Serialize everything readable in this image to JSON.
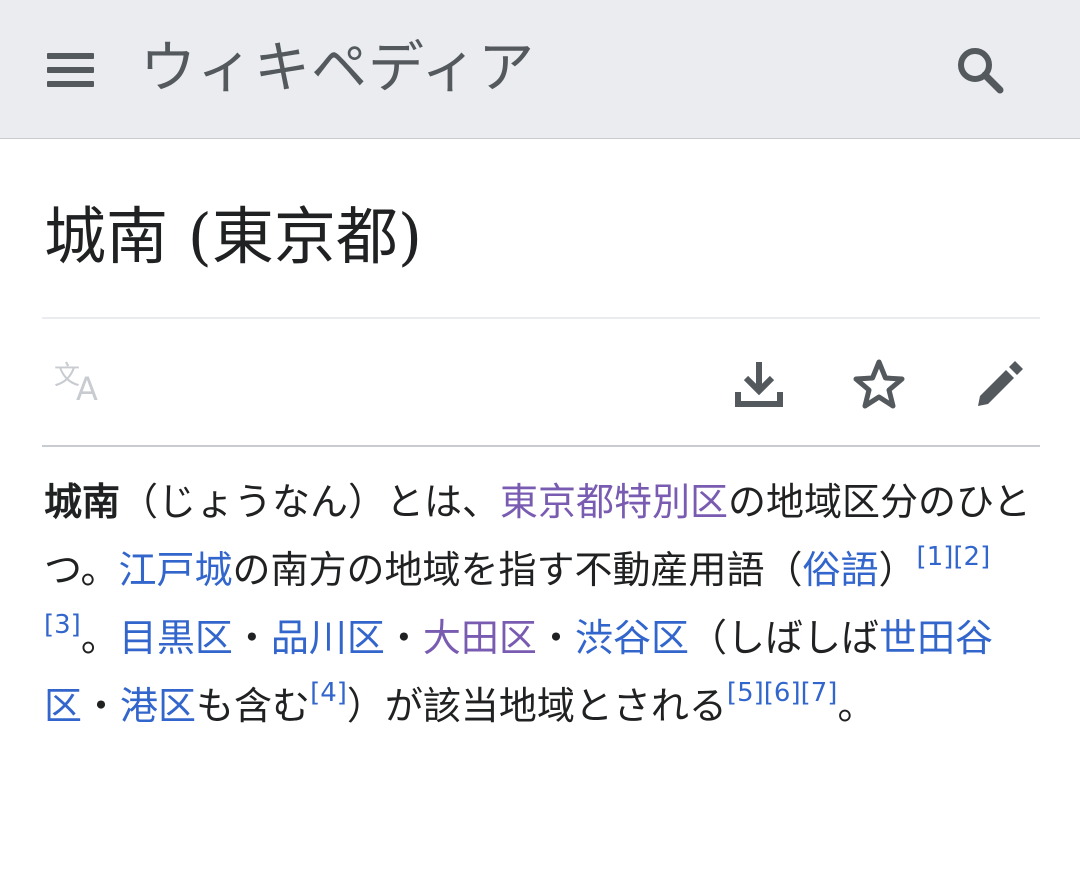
{
  "header": {
    "logo_text": "ウィキペディア"
  },
  "page": {
    "title": "城南 (東京都)"
  },
  "icons": {
    "menu": "hamburger-menu-icon",
    "search": "search-icon",
    "language": "language-icon",
    "download": "download-icon",
    "watch": "star-icon",
    "edit": "pencil-icon"
  },
  "colors": {
    "header_bg": "#eaecf0",
    "link": "#3366cc",
    "visited_link": "#795cb2",
    "text": "#202122",
    "icon": "#54595d",
    "disabled_icon": "#c8ccd1"
  },
  "article": {
    "term": "城南",
    "reading": "（じょうなん）とは、",
    "link_tokyo_special_wards": "東京都特別区",
    "text_1": "の地域区分のひとつ。",
    "link_edo_castle": "江戸城",
    "text_2": "の南方の地域を指す不動産用語（",
    "link_colloquial": "俗語",
    "text_3": "）",
    "ref_1": "[1]",
    "ref_2": "[2]",
    "ref_3": "[3]",
    "text_4": "。",
    "link_meguro": "目黒区",
    "sep_1": "・",
    "link_shinagawa": "品川区",
    "sep_2": "・",
    "link_ota": "大田区",
    "sep_3": "・",
    "link_shibuya": "渋谷区",
    "text_5": "（しばしば",
    "link_setagaya": "世田谷区",
    "sep_4": "・",
    "link_minato": "港区",
    "text_6": "も含む",
    "ref_4": "[4]",
    "text_7": "）が該当地域とされる",
    "ref_5": "[5]",
    "ref_6": "[6]",
    "ref_7": "[7]",
    "text_8": "。"
  }
}
